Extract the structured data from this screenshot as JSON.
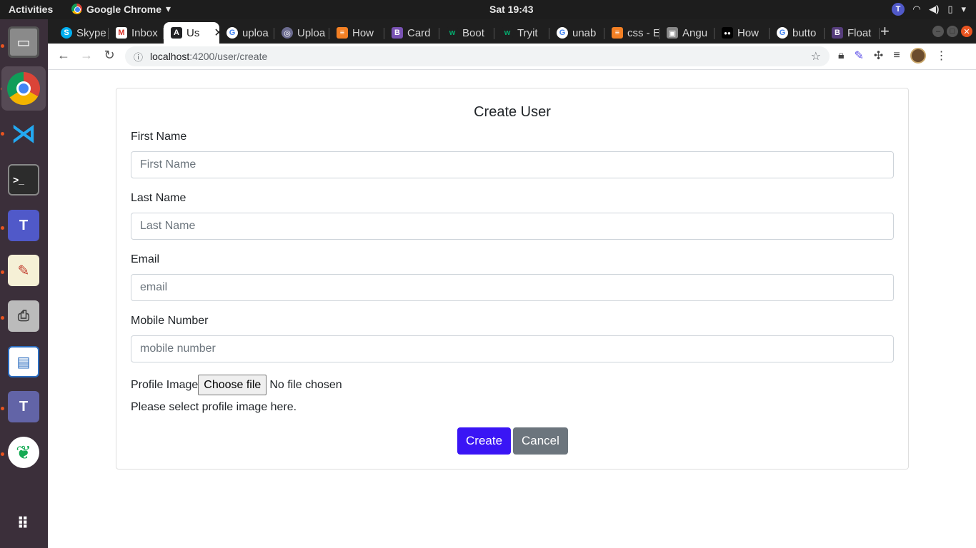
{
  "topbar": {
    "activities": "Activities",
    "app_name": "Google Chrome",
    "clock": "Sat 19:43"
  },
  "dock": {
    "items": [
      "files",
      "chrome",
      "vscode",
      "terminal",
      "teams",
      "text-editor",
      "scanner",
      "writer",
      "teams-preview",
      "mongodb",
      "show-apps"
    ]
  },
  "tabs": [
    {
      "label": "Skype",
      "favicon": "S",
      "color": "#00aff0"
    },
    {
      "label": "Inbox",
      "favicon": "M",
      "color": "#d93025"
    },
    {
      "label": "Us",
      "favicon": "A",
      "color": "#202124"
    },
    {
      "label": "uploa",
      "favicon": "G",
      "color": "#4285f4"
    },
    {
      "label": "Uploa",
      "favicon": "◎",
      "color": "#6b6b8f"
    },
    {
      "label": "How",
      "favicon": "≡",
      "color": "#f48024"
    },
    {
      "label": "Card",
      "favicon": "B",
      "color": "#7952b3"
    },
    {
      "label": "Boot",
      "favicon": "w",
      "color": "#04aa6d"
    },
    {
      "label": "Tryit",
      "favicon": "w",
      "color": "#04aa6d"
    },
    {
      "label": "unab",
      "favicon": "G",
      "color": "#4285f4"
    },
    {
      "label": "css - E",
      "favicon": "≡",
      "color": "#f48024"
    },
    {
      "label": "Angu",
      "favicon": "▣",
      "color": "#888"
    },
    {
      "label": "How",
      "favicon": "●●",
      "color": "#000"
    },
    {
      "label": "butto",
      "favicon": "G",
      "color": "#4285f4"
    },
    {
      "label": "Float",
      "favicon": "B",
      "color": "#563d7c"
    }
  ],
  "omnibox": {
    "host": "localhost",
    "path": ":4200/user/create"
  },
  "form": {
    "title": "Create User",
    "first_name_label": "First Name",
    "first_name_placeholder": "First Name",
    "last_name_label": "Last Name",
    "last_name_placeholder": "Last Name",
    "email_label": "Email",
    "email_placeholder": "email",
    "mobile_label": "Mobile Number",
    "mobile_placeholder": "mobile number",
    "profile_label": "Profile Image",
    "file_button": "Choose file",
    "file_status": "No file chosen",
    "help_text": "Please select profile image here.",
    "create_label": "Create",
    "cancel_label": "Cancel"
  },
  "colors": {
    "primary": "#3a15f5",
    "secondary": "#6c757d",
    "dock": "#3b2f3a"
  }
}
